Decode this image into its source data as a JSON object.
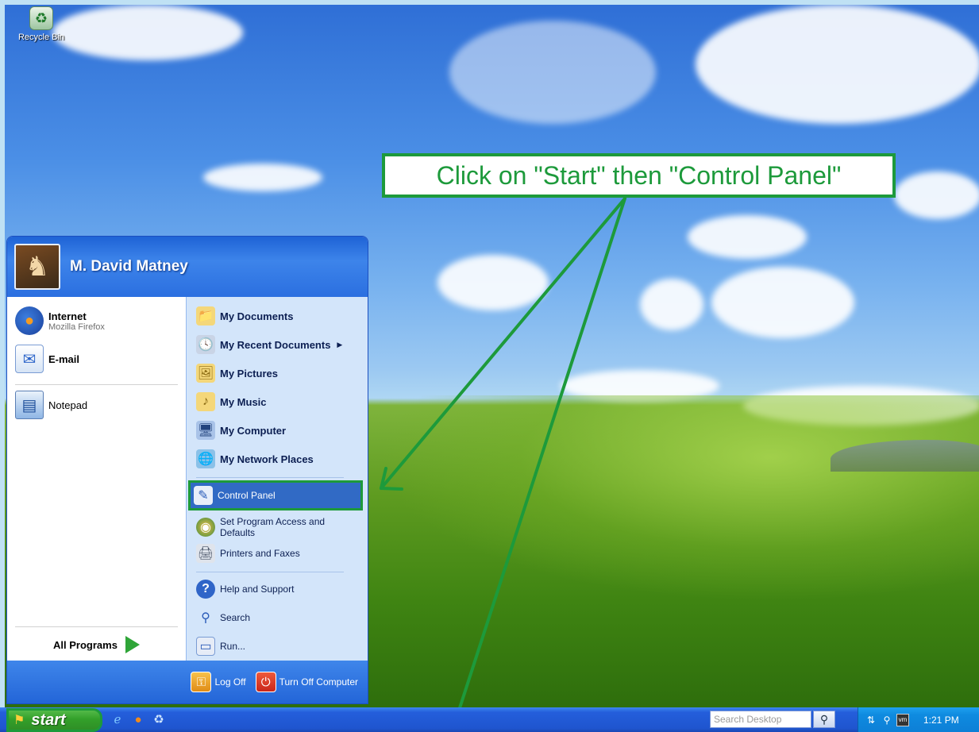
{
  "desktop": {
    "recycle_bin_label": "Recycle Bin"
  },
  "callout": {
    "text": "Click on \"Start\" then \"Control Panel\""
  },
  "start_menu": {
    "user_name": "M. David Matney",
    "left": {
      "pinned": [
        {
          "label": "Internet",
          "sublabel": "Mozilla Firefox",
          "icon": "firefox-icon"
        },
        {
          "label": "E-mail",
          "icon": "email-icon"
        }
      ],
      "recent": [
        {
          "label": "Notepad",
          "icon": "notepad-icon"
        }
      ],
      "all_programs": "All Programs"
    },
    "right": {
      "group1": [
        {
          "label": "My Documents",
          "icon": "folder-documents-icon"
        },
        {
          "label": "My Recent Documents",
          "icon": "recent-documents-icon",
          "submenu_arrow": "▶"
        },
        {
          "label": "My Pictures",
          "icon": "folder-pictures-icon"
        },
        {
          "label": "My Music",
          "icon": "folder-music-icon"
        },
        {
          "label": "My Computer",
          "icon": "computer-icon"
        },
        {
          "label": "My Network Places",
          "icon": "network-icon"
        }
      ],
      "group2": [
        {
          "label": "Control Panel",
          "icon": "control-panel-icon",
          "highlighted": true
        },
        {
          "label": "Set Program Access and Defaults",
          "icon": "program-access-icon"
        },
        {
          "label": "Printers and Faxes",
          "icon": "printer-icon"
        }
      ],
      "group3": [
        {
          "label": "Help and Support",
          "icon": "help-icon"
        },
        {
          "label": "Search",
          "icon": "search-icon"
        },
        {
          "label": "Run...",
          "icon": "run-icon"
        }
      ]
    },
    "footer": {
      "log_off": "Log Off",
      "turn_off": "Turn Off Computer"
    }
  },
  "taskbar": {
    "start_label": "start",
    "search_placeholder": "Search Desktop",
    "clock": "1:21 PM"
  },
  "colors": {
    "callout_green": "#1d9a3b",
    "xp_blue": "#245edb",
    "highlight_blue": "#316ac5"
  }
}
